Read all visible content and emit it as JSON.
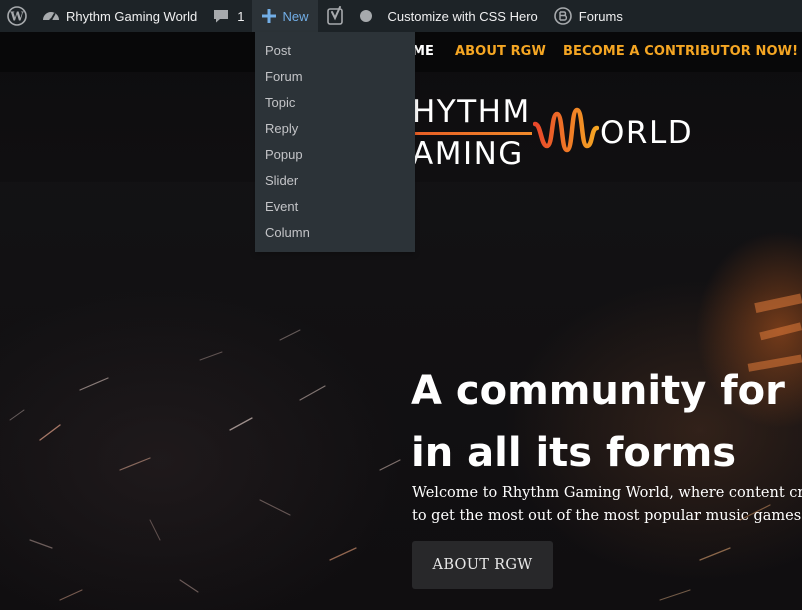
{
  "admin_bar": {
    "wp_logo_icon": "wordpress-icon",
    "site_name": "Rhythm Gaming World",
    "site_icon": "dashboard-icon",
    "comments_count": "1",
    "comments_icon": "speech-bubble-icon",
    "new_label": "New",
    "new_icon": "plus-icon",
    "yoast_icon": "yoast-icon",
    "status_dot_color": "#a7aaad",
    "css_hero_label": "Customize with CSS Hero",
    "forums_label": "Forums",
    "forums_icon": "buddypress-icon",
    "bar_color": "#1d2327",
    "highlight_color": "#72aee6"
  },
  "new_menu": {
    "items": [
      "Post",
      "Forum",
      "Topic",
      "Reply",
      "Popup",
      "Slider",
      "Event",
      "Column"
    ]
  },
  "site_nav": {
    "home": "ME",
    "about": "ABOUT RGW",
    "contribute": "BECOME A CONTRIBUTOR NOW!",
    "accent_color": "#f5a623"
  },
  "logo": {
    "rhythm": "HYTHM",
    "gaming": "AMING",
    "world": "ORLD",
    "wave_icon": "soundwave-w-icon"
  },
  "hero": {
    "title_line1": "A community for m",
    "title_line2": "in all its forms",
    "desc_line1": "Welcome to Rhythm Gaming World, where content crea",
    "desc_line2": "to get the most out of the most popular music games",
    "button_label": "ABOUT RGW"
  }
}
